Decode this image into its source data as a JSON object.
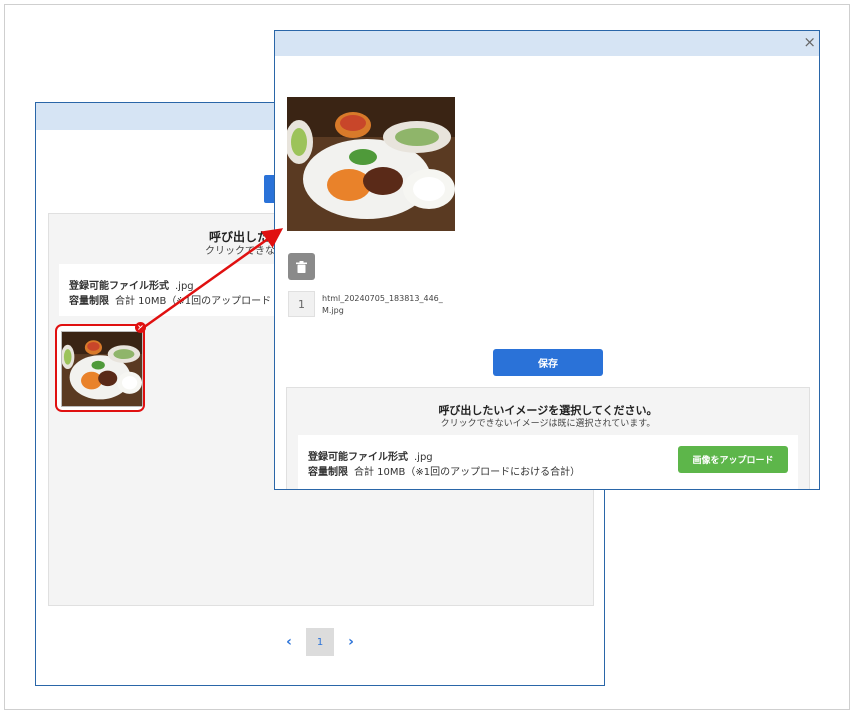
{
  "dialog": {
    "title": "呼び出したいイメージを選択してください。",
    "subtitle": "クリックできないイメージは既に選択されています。",
    "back_title": "呼び出した",
    "back_subtitle": "クリックできな",
    "format_label": "登録可能ファイル形式",
    "format_value": ".jpg",
    "size_label": "容量制限",
    "size_value": "合計 10MB（※1回のアップロードにおける合計）",
    "back_size_value": "合計 10MB（※1回のアップロード",
    "upload_button": "画像をアップロード",
    "save_button": "保存",
    "close_icon": "×"
  },
  "selected_file": {
    "index": "1",
    "name": "html_20240705_183813_446_M.jpg"
  },
  "pagination": {
    "prev": "‹",
    "current": "1",
    "next": "›"
  },
  "colors": {
    "accent_blue": "#2a72d8",
    "upload_green": "#5db64a",
    "highlight_red": "#e01010",
    "header_blue": "#d6e4f4"
  }
}
